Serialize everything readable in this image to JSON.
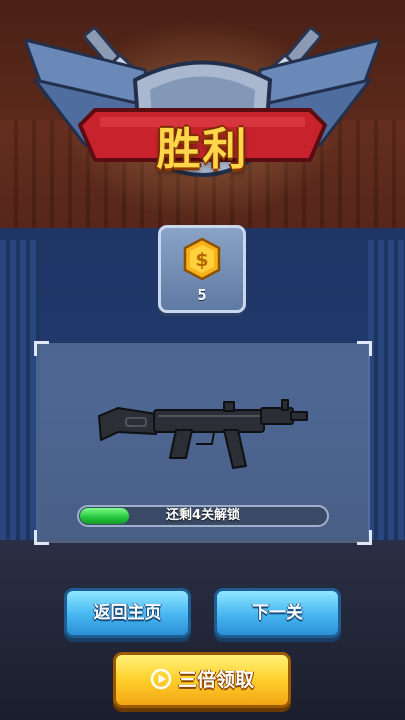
{
  "banner": {
    "title": "胜利"
  },
  "reward": {
    "icon": "dollar-coin-icon",
    "amount": "5"
  },
  "weapon": {
    "icon": "submachine-gun-icon",
    "unlock_progress": 0.2,
    "unlock_text": "还剩4关解锁"
  },
  "buttons": {
    "back_label": "返回主页",
    "next_label": "下一关",
    "triple_label": "三倍领取",
    "triple_icon": "play-circle-icon"
  },
  "colors": {
    "title_gold": "#ffd64a",
    "progress_green": "#23c43a",
    "button_blue": "#46b6f0",
    "button_gold": "#ffcf2a"
  }
}
